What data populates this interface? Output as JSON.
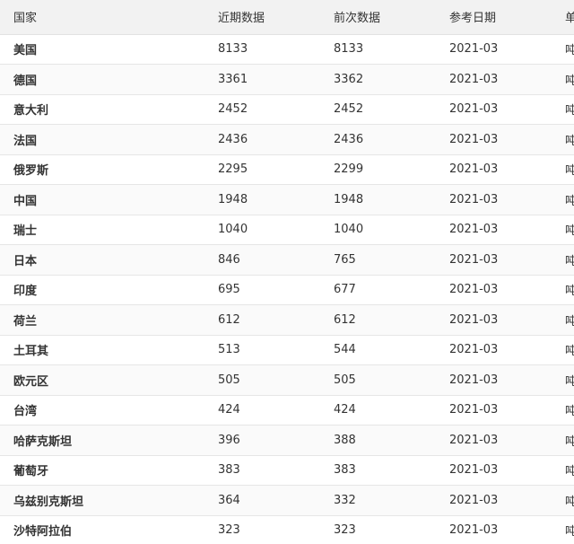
{
  "headers": {
    "country": "国家",
    "recent": "近期数据",
    "previous": "前次数据",
    "ref_date": "参考日期",
    "unit": "单位"
  },
  "rows": [
    {
      "country": "美国",
      "recent": "8133",
      "previous": "8133",
      "ref_date": "2021-03",
      "unit": "吨"
    },
    {
      "country": "德国",
      "recent": "3361",
      "previous": "3362",
      "ref_date": "2021-03",
      "unit": "吨"
    },
    {
      "country": "意大利",
      "recent": "2452",
      "previous": "2452",
      "ref_date": "2021-03",
      "unit": "吨"
    },
    {
      "country": "法国",
      "recent": "2436",
      "previous": "2436",
      "ref_date": "2021-03",
      "unit": "吨"
    },
    {
      "country": "俄罗斯",
      "recent": "2295",
      "previous": "2299",
      "ref_date": "2021-03",
      "unit": "吨"
    },
    {
      "country": "中国",
      "recent": "1948",
      "previous": "1948",
      "ref_date": "2021-03",
      "unit": "吨"
    },
    {
      "country": "瑞士",
      "recent": "1040",
      "previous": "1040",
      "ref_date": "2021-03",
      "unit": "吨"
    },
    {
      "country": "日本",
      "recent": "846",
      "previous": "765",
      "ref_date": "2021-03",
      "unit": "吨"
    },
    {
      "country": "印度",
      "recent": "695",
      "previous": "677",
      "ref_date": "2021-03",
      "unit": "吨"
    },
    {
      "country": "荷兰",
      "recent": "612",
      "previous": "612",
      "ref_date": "2021-03",
      "unit": "吨"
    },
    {
      "country": "土耳其",
      "recent": "513",
      "previous": "544",
      "ref_date": "2021-03",
      "unit": "吨"
    },
    {
      "country": "欧元区",
      "recent": "505",
      "previous": "505",
      "ref_date": "2021-03",
      "unit": "吨"
    },
    {
      "country": "台湾",
      "recent": "424",
      "previous": "424",
      "ref_date": "2021-03",
      "unit": "吨"
    },
    {
      "country": "哈萨克斯坦",
      "recent": "396",
      "previous": "388",
      "ref_date": "2021-03",
      "unit": "吨"
    },
    {
      "country": "葡萄牙",
      "recent": "383",
      "previous": "383",
      "ref_date": "2021-03",
      "unit": "吨"
    },
    {
      "country": "乌兹别克斯坦",
      "recent": "364",
      "previous": "332",
      "ref_date": "2021-03",
      "unit": "吨"
    },
    {
      "country": "沙特阿拉伯",
      "recent": "323",
      "previous": "323",
      "ref_date": "2021-03",
      "unit": "吨"
    }
  ]
}
